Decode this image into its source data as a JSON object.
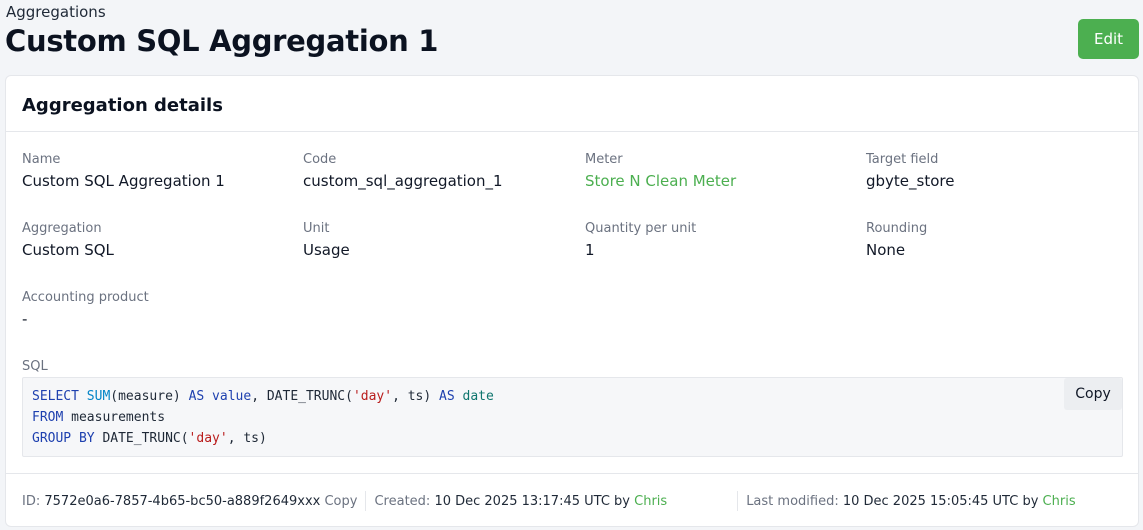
{
  "breadcrumb": "Aggregations",
  "title": "Custom SQL Aggregation 1",
  "edit_label": "Edit",
  "card_title": "Aggregation details",
  "fields": {
    "name": {
      "label": "Name",
      "value": "Custom SQL Aggregation 1"
    },
    "code": {
      "label": "Code",
      "value": "custom_sql_aggregation_1"
    },
    "meter": {
      "label": "Meter",
      "value": "Store N Clean Meter"
    },
    "target_field": {
      "label": "Target field",
      "value": "gbyte_store"
    },
    "aggregation": {
      "label": "Aggregation",
      "value": "Custom SQL"
    },
    "unit": {
      "label": "Unit",
      "value": "Usage"
    },
    "quantity_per_unit": {
      "label": "Quantity per unit",
      "value": "1"
    },
    "rounding": {
      "label": "Rounding",
      "value": "None"
    },
    "accounting_product": {
      "label": "Accounting product",
      "value": "-"
    }
  },
  "sql": {
    "label": "SQL",
    "copy_label": "Copy",
    "tokens": {
      "select": "SELECT",
      "sum": "SUM",
      "measure_open": "(measure) ",
      "as1": "AS",
      "value": "value",
      "comma_trunc": ", DATE_TRUNC(",
      "day1": "'day'",
      "ts_close": ", ts) ",
      "as2": "AS",
      "date": "date",
      "from": "FROM",
      "measurements": " measurements",
      "group_by": "GROUP BY",
      "trunc2": " DATE_TRUNC(",
      "day2": "'day'",
      "ts_close2": ", ts)"
    }
  },
  "footer": {
    "id_label": "ID:",
    "id_value": "7572e0a6-7857-4b65-bc50-a889f2649xxx",
    "id_copy": "Copy",
    "created_label": "Created:",
    "created_value": "10 Dec 2025 13:17:45 UTC",
    "by1": "by",
    "created_by": "Chris",
    "modified_label": "Last modified:",
    "modified_value": "10 Dec 2025 15:05:45 UTC",
    "by2": "by",
    "modified_by": "Chris"
  },
  "colors": {
    "accent": "#4caf50",
    "keyword": "#1e40af",
    "string": "#b91c1c"
  }
}
